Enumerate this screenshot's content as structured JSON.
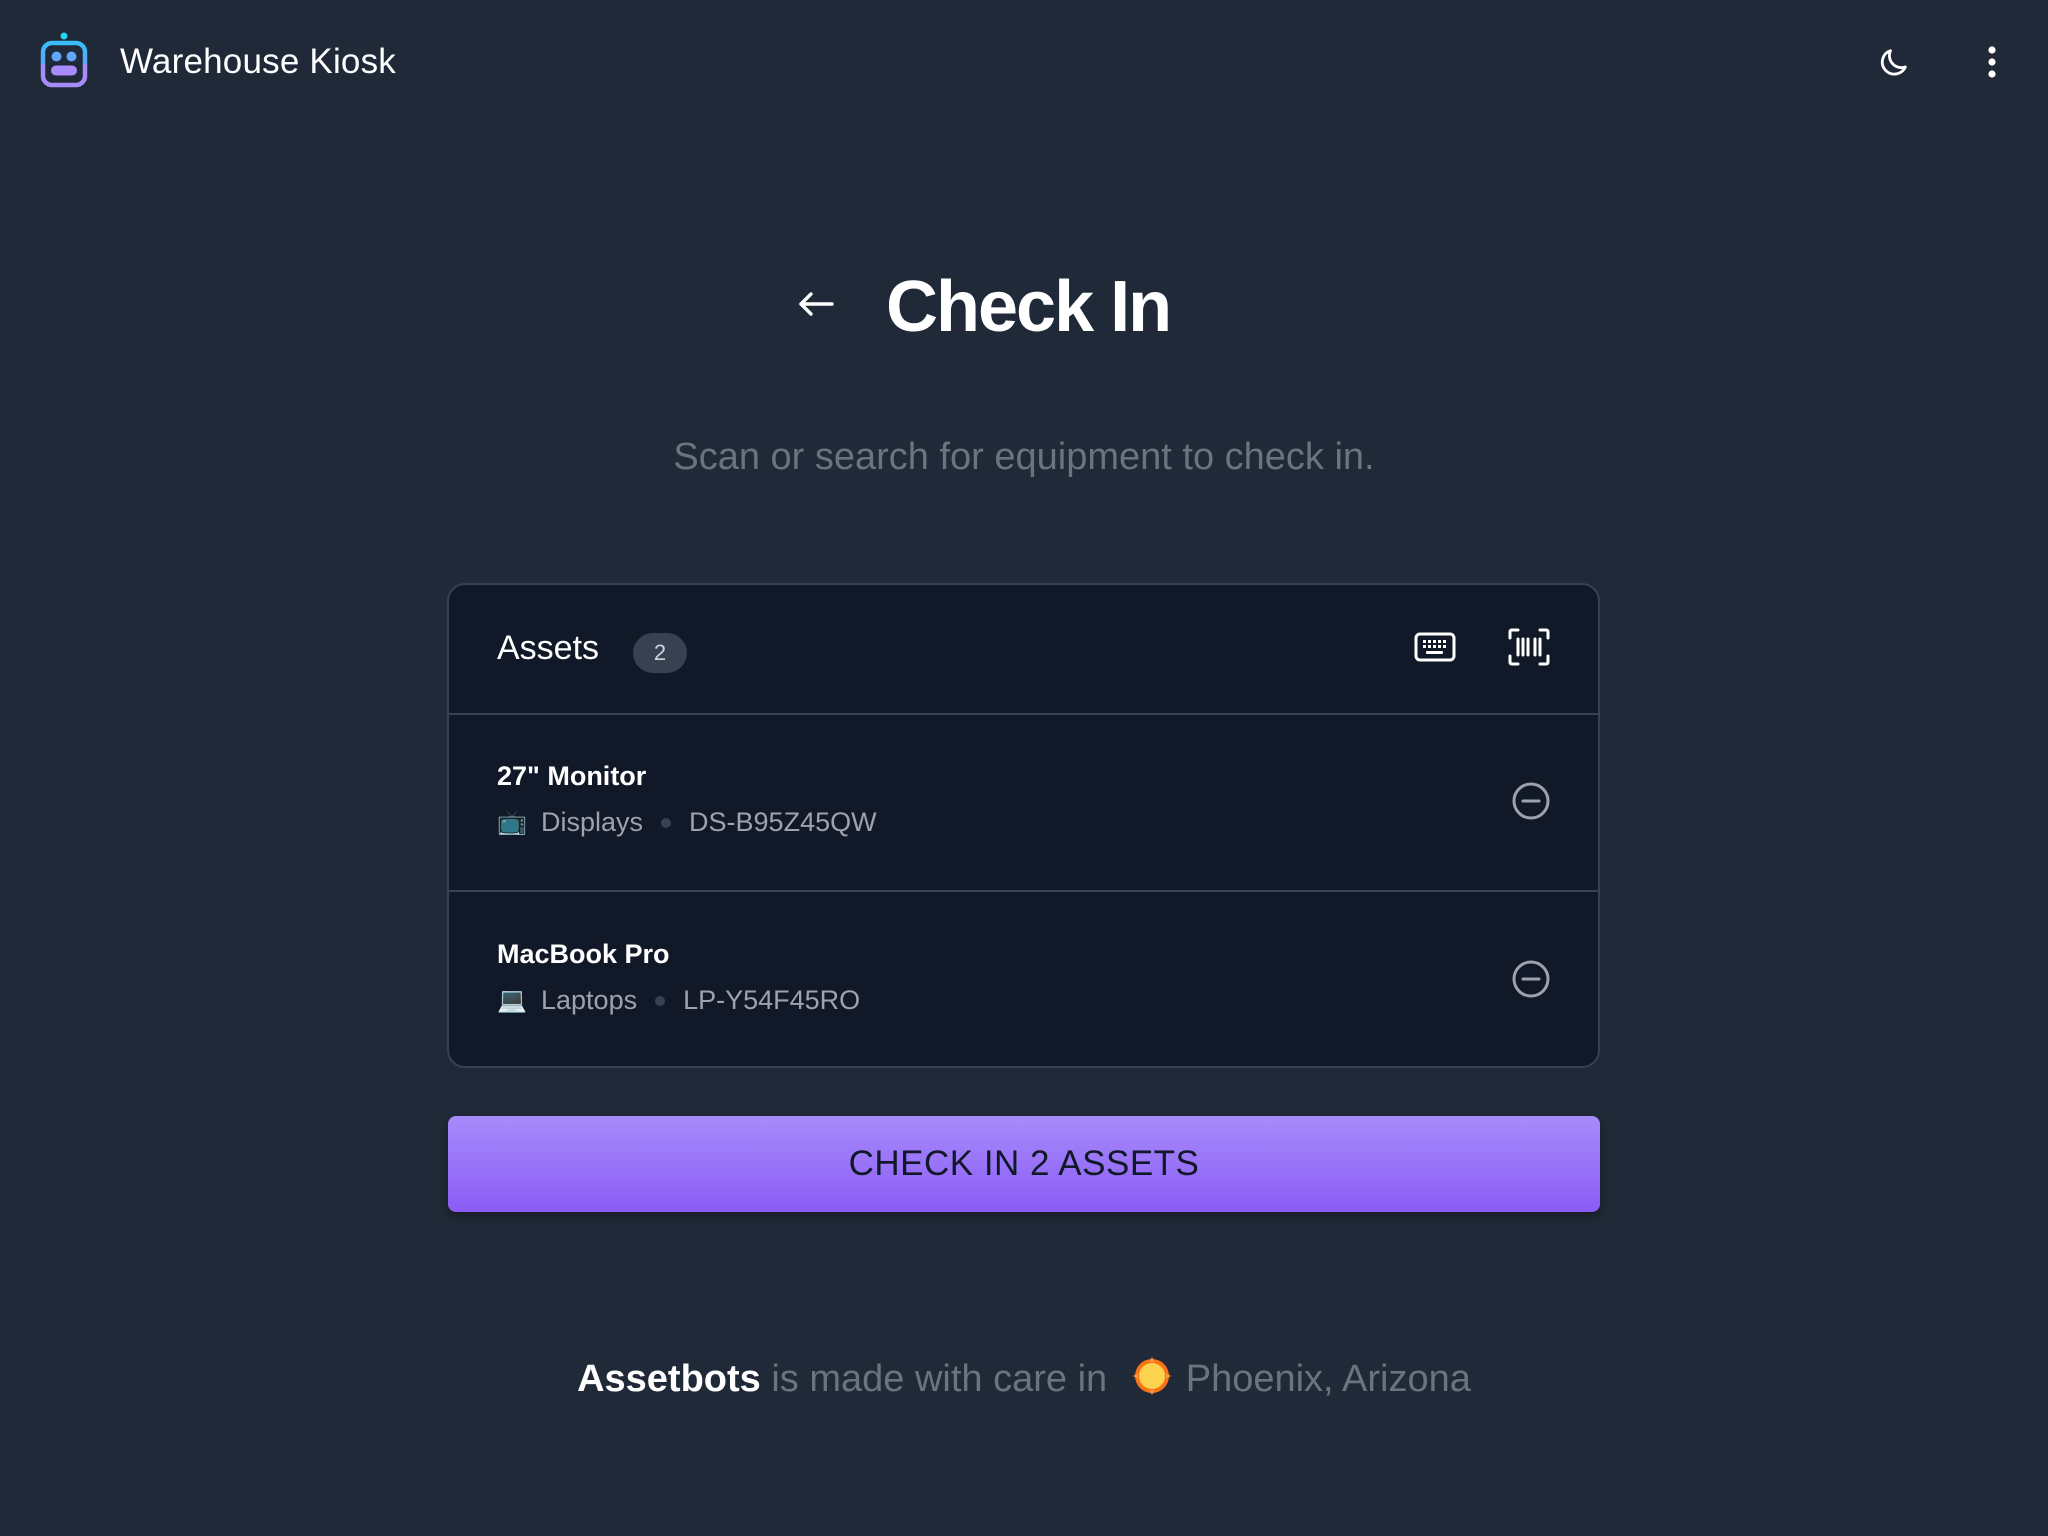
{
  "app": {
    "title": "Warehouse Kiosk",
    "logo_icon": "robot-logo-icon",
    "theme_toggle_icon": "moon-icon",
    "menu_icon": "more-vertical-icon"
  },
  "page": {
    "back_icon": "arrow-left-icon",
    "title": "Check In",
    "subtitle": "Scan or search for equipment to check in."
  },
  "assets_card": {
    "title": "Assets",
    "count": "2",
    "keyboard_icon": "keyboard-icon",
    "scan_icon": "barcode-scan-icon",
    "items": [
      {
        "name": "27\" Monitor",
        "category_emoji": "📺",
        "category": "Displays",
        "tag": "DS-B95Z45QW",
        "remove_icon": "minus-circle-icon"
      },
      {
        "name": "MacBook Pro",
        "category_emoji": "💻",
        "category": "Laptops",
        "tag": "LP-Y54F45RO",
        "remove_icon": "minus-circle-icon"
      }
    ]
  },
  "primary_action": {
    "label": "CHECK IN 2 ASSETS"
  },
  "footer": {
    "brand": "Assetbots",
    "text_before_icon": " is made with care in ",
    "location": "Phoenix, Arizona",
    "icon": "sun-icon"
  },
  "colors": {
    "background": "#1f2937",
    "card": "#111827",
    "border": "#374151",
    "accent_top": "#a78bfa",
    "accent_bottom": "#8b5cf6",
    "muted_text": "#6b7280"
  }
}
